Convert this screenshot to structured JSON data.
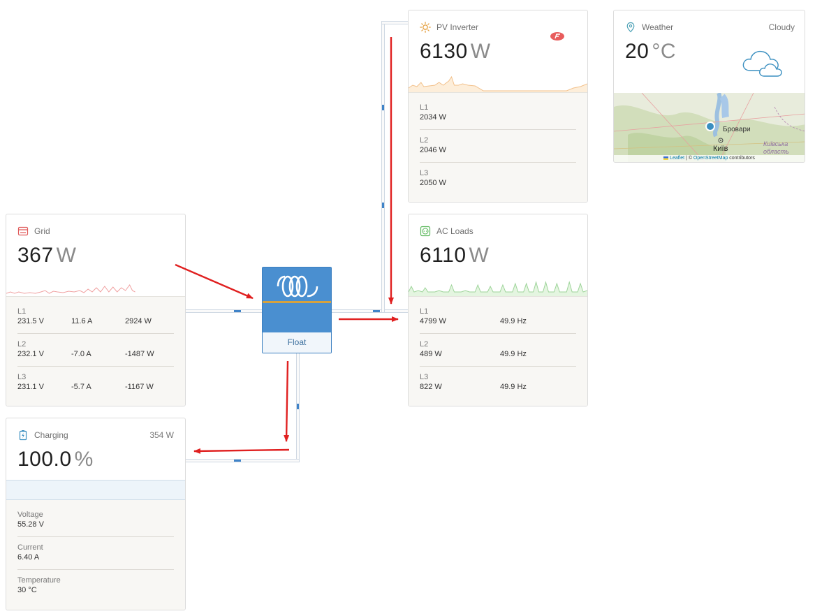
{
  "pv_inverter": {
    "title": "PV Inverter",
    "value": "6130",
    "unit": "W",
    "badge_icon": "fronius-logo-icon",
    "rows": [
      {
        "label": "L1",
        "value": "2034 W"
      },
      {
        "label": "L2",
        "value": "2046 W"
      },
      {
        "label": "L3",
        "value": "2050 W"
      }
    ]
  },
  "weather": {
    "title": "Weather",
    "condition": "Cloudy",
    "value": "20",
    "unit": "°C",
    "icon": "cloud-icon",
    "map": {
      "labels": [
        "Бровари",
        "Київ",
        "Київська область"
      ],
      "attribution_leaflet": "Leaflet",
      "attribution_sep": " | © ",
      "attribution_osm": "OpenStreetMap",
      "attribution_tail": " contributors"
    }
  },
  "grid": {
    "title": "Grid",
    "value": "367",
    "unit": "W",
    "rows": [
      {
        "label": "L1",
        "voltage": "231.5 V",
        "current": "11.6 A",
        "power": "2924 W"
      },
      {
        "label": "L2",
        "voltage": "232.1 V",
        "current": "-7.0 A",
        "power": "-1487 W"
      },
      {
        "label": "L3",
        "voltage": "231.1 V",
        "current": "-5.7 A",
        "power": "-1167 W"
      }
    ]
  },
  "ac_loads": {
    "title": "AC Loads",
    "value": "6110",
    "unit": "W",
    "rows": [
      {
        "label": "L1",
        "power": "4799 W",
        "freq": "49.9 Hz"
      },
      {
        "label": "L2",
        "power": "489 W",
        "freq": "49.9 Hz"
      },
      {
        "label": "L3",
        "power": "822 W",
        "freq": "49.9 Hz"
      }
    ]
  },
  "inverter": {
    "state": "Float",
    "logo": "victron-logo-icon"
  },
  "battery": {
    "title": "Charging",
    "power": "354 W",
    "value": "100.0",
    "unit": "%",
    "soc_fraction": 1.0,
    "rows": [
      {
        "label": "Voltage",
        "value": "55.28 V"
      },
      {
        "label": "Current",
        "value": "6.40 A"
      },
      {
        "label": "Temperature",
        "value": "30 °C"
      }
    ]
  },
  "colors": {
    "grid_accent": "#e05a5a",
    "pv_accent": "#e5a040",
    "loads_accent": "#5cb85c",
    "battery_accent": "#3a8fc0",
    "arrow": "#e02020",
    "inverter_blue": "#4a8fd0"
  }
}
